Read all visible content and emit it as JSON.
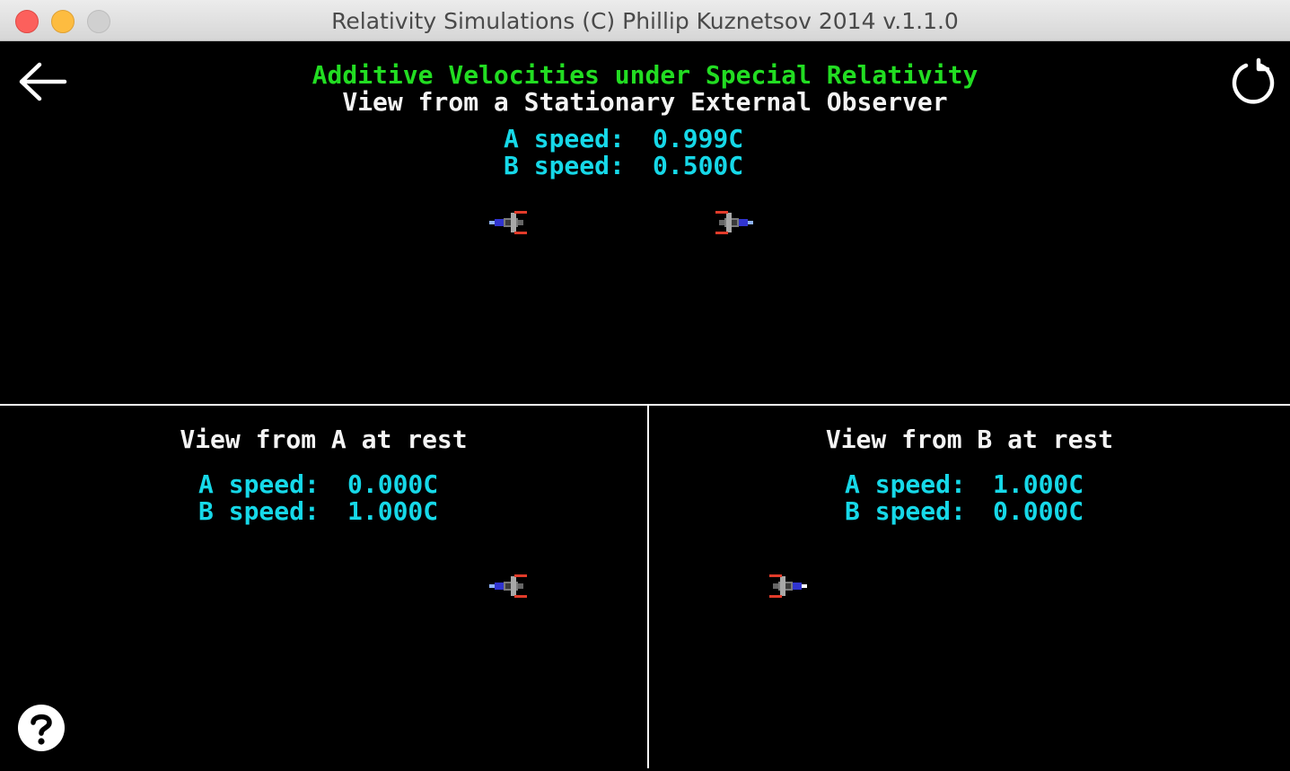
{
  "window": {
    "title": "Relativity Simulations (C) Phillip Kuznetsov 2014 v.1.1.0"
  },
  "colors": {
    "title_green": "#22dd22",
    "speed_cyan": "#16d8e8",
    "text_white": "#f4f4f4",
    "background": "#000000"
  },
  "toolbar": {
    "back_icon": "arrow-left-icon",
    "reload_icon": "reload-icon",
    "help_icon": "help-icon"
  },
  "stationary_view": {
    "title": "Additive Velocities under Special Relativity",
    "subtitle": "View from a Stationary External Observer",
    "a_speed_label": "A speed:",
    "a_speed_value": "0.999C",
    "b_speed_label": "B speed:",
    "b_speed_value": "0.500C"
  },
  "view_a": {
    "title": "View from A at rest",
    "a_speed_label": "A speed:",
    "a_speed_value": "0.000C",
    "b_speed_label": "B speed:",
    "b_speed_value": "1.000C"
  },
  "view_b": {
    "title": "View from B at rest",
    "a_speed_label": "A speed:",
    "a_speed_value": "1.000C",
    "b_speed_label": "B speed:",
    "b_speed_value": "0.000C"
  }
}
